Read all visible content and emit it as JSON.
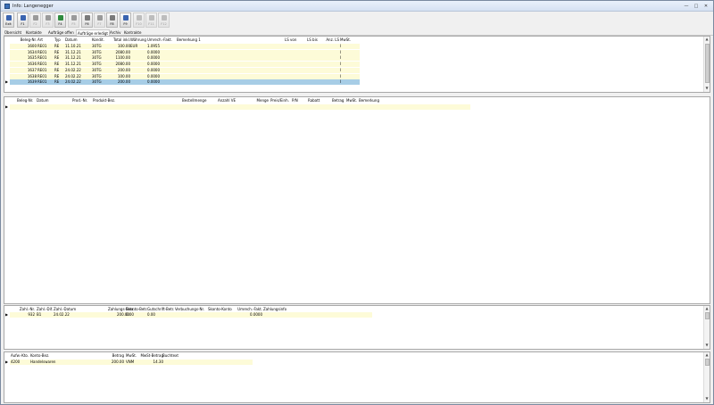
{
  "window": {
    "title": "Info: Langenegger",
    "minimize": "—",
    "maximize": "□",
    "close": "✕"
  },
  "toolbar": [
    {
      "key": "exit",
      "label": "Exit",
      "icon": "exit-icon",
      "color": "#3a64b0",
      "enabled": true
    },
    {
      "key": "f1",
      "label": "F1",
      "icon": "user-icon",
      "color": "#3a64b0",
      "enabled": true
    },
    {
      "key": "f2",
      "label": "F2",
      "icon": "document-icon",
      "color": "#9a9a9a",
      "enabled": false
    },
    {
      "key": "f3",
      "label": "F3",
      "icon": "delete-icon",
      "color": "#9a9a9a",
      "enabled": false
    },
    {
      "key": "f4",
      "label": "F4",
      "icon": "save-icon",
      "color": "#2e8b3d",
      "enabled": true
    },
    {
      "key": "f5",
      "label": "F5",
      "icon": "undo-icon",
      "color": "#9a9a9a",
      "enabled": false
    },
    {
      "key": "f6",
      "label": "F6",
      "icon": "search-icon",
      "color": "#7a7a7a",
      "enabled": true
    },
    {
      "key": "f7",
      "label": "F7",
      "icon": "calendar-icon",
      "color": "#9a9a9a",
      "enabled": false
    },
    {
      "key": "f8",
      "label": "F8",
      "icon": "print-icon",
      "color": "#7a7a7a",
      "enabled": true
    },
    {
      "key": "f9",
      "label": "F9",
      "icon": "copy-icon",
      "color": "#3a64b0",
      "enabled": true
    },
    {
      "key": "f10",
      "label": "F10",
      "icon": "blank-icon",
      "color": "#bdbdbd",
      "enabled": false
    },
    {
      "key": "f11",
      "label": "F11",
      "icon": "blank-icon",
      "color": "#bdbdbd",
      "enabled": false
    },
    {
      "key": "f12",
      "label": "F12",
      "icon": "blank-icon",
      "color": "#bdbdbd",
      "enabled": false
    }
  ],
  "tabs": [
    {
      "label": "Übersicht",
      "active": false
    },
    {
      "label": "Kontakte",
      "active": false
    },
    {
      "label": "Aufträge offen",
      "active": false
    },
    {
      "label": "Aufträge erledigt",
      "active": true
    },
    {
      "label": "Archiv",
      "active": false
    },
    {
      "label": "Kontrakte",
      "active": false
    }
  ],
  "orders": {
    "columns": [
      "Beleg-Nr.",
      "Art",
      "Typ",
      "Datum",
      "Kondit.",
      "Total inkl.",
      "Währung",
      "Umrech.-Fakt.",
      "Bemerkung 1",
      "LS von",
      "LS bis",
      "Anz. LS",
      "MwSt."
    ],
    "rows": [
      [
        "1600",
        "RE01",
        "RE",
        "11.10.21",
        "30TG",
        "100.00",
        "EUR",
        "1.0955",
        "",
        "",
        "",
        "",
        "I"
      ],
      [
        "1634",
        "RE01",
        "RE",
        "31.12.21",
        "30TG",
        "2080.00",
        "",
        "0.0000",
        "",
        "",
        "",
        "",
        "I"
      ],
      [
        "1635",
        "RE01",
        "RE",
        "31.12.21",
        "30TG",
        "1100.00",
        "",
        "0.0000",
        "",
        "",
        "",
        "",
        "I"
      ],
      [
        "1636",
        "RE01",
        "RE",
        "31.12.21",
        "30TG",
        "2080.00",
        "",
        "0.0000",
        "",
        "",
        "",
        "",
        "I"
      ],
      [
        "1637",
        "RE01",
        "RE",
        "24.02.22",
        "30TG",
        "200.00",
        "",
        "0.0000",
        "",
        "",
        "",
        "",
        "I"
      ],
      [
        "1638",
        "RE01",
        "RE",
        "24.02.22",
        "30TG",
        "100.00",
        "",
        "0.0000",
        "",
        "",
        "",
        "",
        "I"
      ],
      [
        "1639",
        "RE01",
        "RE",
        "24.02.22",
        "30TG",
        "200.00",
        "",
        "0.0000",
        "",
        "",
        "",
        "",
        "I"
      ]
    ],
    "selected_row": 6
  },
  "positions": {
    "columns": [
      "Beleg-Nr.",
      "Datum",
      "Prod.-Nr.",
      "Produkt-Bez.",
      "Bestellmenge",
      "Anzahl VE",
      "Menge",
      "Preis/Einh.",
      "P/N",
      "Rabatt",
      "Betrag",
      "MwSt.",
      "Bemerkung"
    ]
  },
  "payments": {
    "columns": [
      "Zahl.-Nr.",
      "Zahl.-Dif.",
      "Zahl.-Datum",
      "Zahlungs-Betr.",
      "Skonto-Betr.",
      "Gutschrift-Betr.",
      "Verbuchungs-Nr.",
      "Skonto-Konto",
      "Umrech.-Fakt.",
      "Zahlungsinfo"
    ],
    "rows": [
      [
        "932",
        "B1",
        "24.02.22",
        "200.00",
        "0.00",
        "0.00",
        "",
        "",
        "0.0000",
        ""
      ]
    ]
  },
  "accounts": {
    "columns": [
      "Aufw.-Kto.",
      "Konto-Bez.",
      "Betrag",
      "MwSt.",
      "MwSt-Betrag",
      "Buchtext"
    ],
    "rows": [
      [
        "4200",
        "Handelswaren",
        "200.00",
        "VNM",
        "14.30",
        ""
      ]
    ]
  },
  "colors": {
    "row_highlight": "#fdfbd8",
    "row_selected": "#a7cde6",
    "window_bg": "#f0f0f0"
  }
}
